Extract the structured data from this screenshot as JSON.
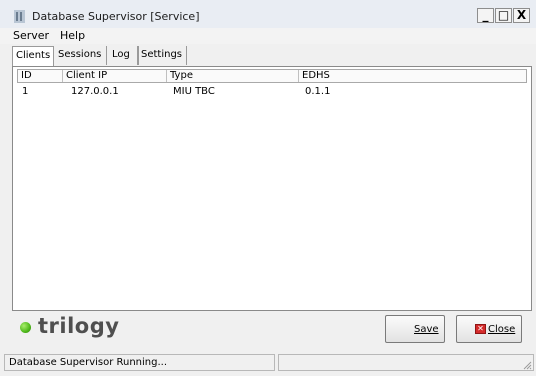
{
  "window": {
    "title": "Database Supervisor [Service]",
    "controls": {
      "minimize": "_",
      "maximize": "□",
      "close": "X"
    }
  },
  "menu": {
    "items": [
      "Server",
      "Help"
    ]
  },
  "tabs": [
    "Clients",
    "Sessions",
    "Log",
    "Settings"
  ],
  "active_tab": "Clients",
  "clients_table": {
    "columns": [
      "ID",
      "Client IP",
      "Type",
      "EDHS"
    ],
    "rows": [
      {
        "id": "1",
        "ip": "127.0.0.1",
        "type": "MIU TBC",
        "edhs": "0.1.1"
      }
    ]
  },
  "logo": {
    "text": "trilogy",
    "dot_color": "#4eb81a"
  },
  "buttons": {
    "save": "Save",
    "close": "Close"
  },
  "status": {
    "text": "Database Supervisor Running..."
  }
}
